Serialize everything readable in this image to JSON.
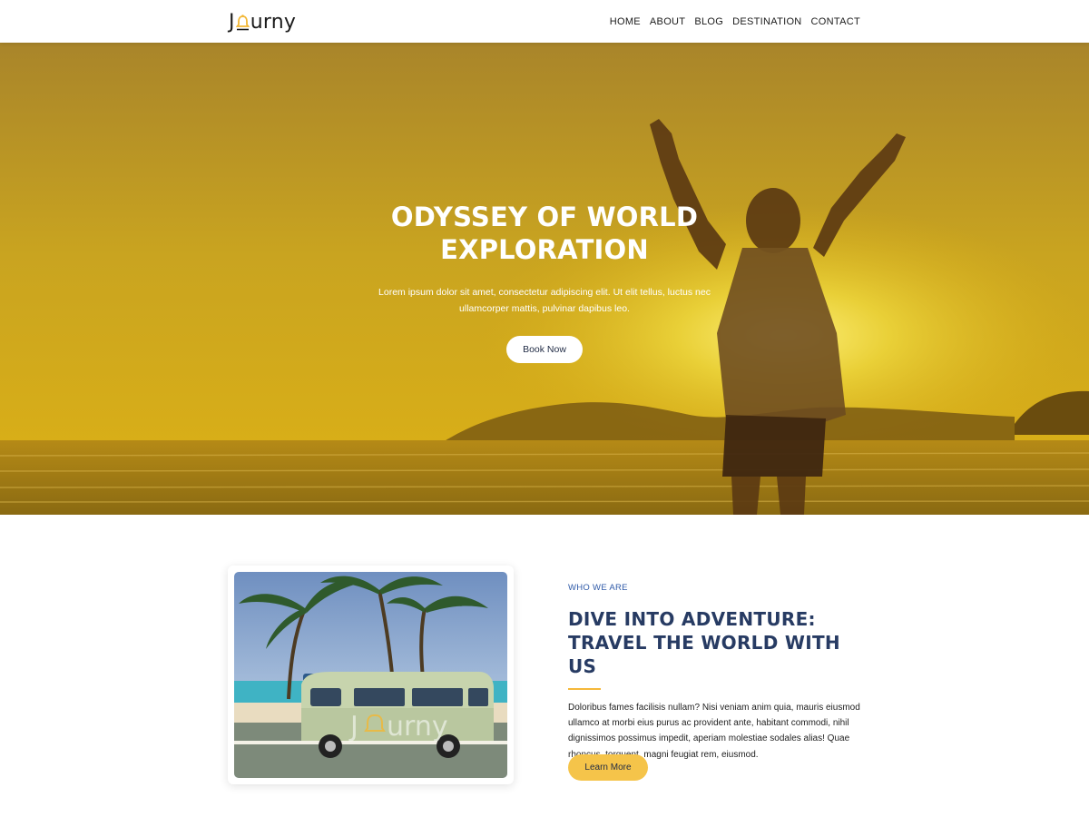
{
  "header": {
    "logo_prefix": "J",
    "logo_suffix": "urny",
    "nav": [
      "HOME",
      "ABOUT",
      "BLOG",
      "DESTINATION",
      "CONTACT"
    ]
  },
  "hero": {
    "title_line1": "ODYSSEY OF WORLD",
    "title_line2": "EXPLORATION",
    "description": "Lorem ipsum dolor sit amet, consectetur adipiscing elit. Ut elit tellus, luctus nec ullamcorper mattis, pulvinar dapibus leo.",
    "button_label": "Book Now"
  },
  "photo": {
    "watermark_prefix": "J",
    "watermark_suffix": "urny"
  },
  "about": {
    "eyebrow": "WHO WE ARE",
    "title": "DIVE INTO ADVENTURE: TRAVEL THE WORLD WITH US",
    "description": "Doloribus fames facilisis nullam? Nisi veniam anim quia, mauris eiusmod ullamco at morbi eius purus ac provident ante, habitant commodi, nihil dignissimos possimus impedit, aperiam molestiae sodales alias! Quae rhoncus, torquent, magni feugiat rem, eiusmod.",
    "button_label": "Learn More"
  },
  "colors": {
    "accent": "#f5c44a",
    "heading": "#273b63",
    "eyebrow": "#2f5aa8",
    "hero_overlay": "#c9a21a"
  }
}
